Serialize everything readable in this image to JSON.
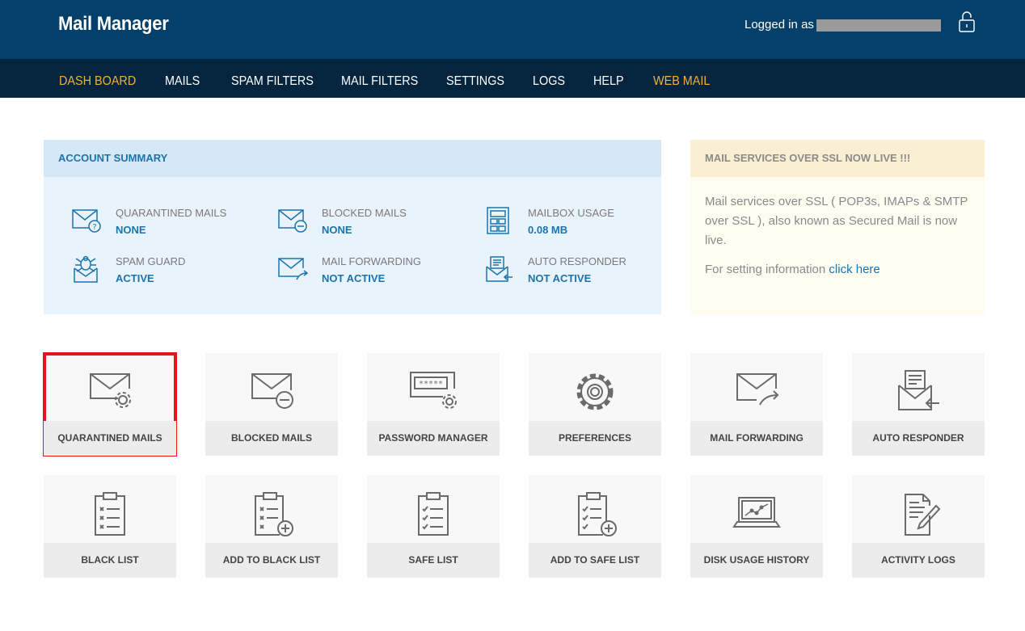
{
  "header": {
    "title": "Mail Manager",
    "login_label": "Logged in as",
    "lock_icon": "lock-icon"
  },
  "nav": [
    {
      "label": "DASH BOARD",
      "accent": true
    },
    {
      "label": "MAILS",
      "accent": false
    },
    {
      "label": "SPAM FILTERS",
      "accent": false
    },
    {
      "label": "MAIL FILTERS",
      "accent": false
    },
    {
      "label": "SETTINGS",
      "accent": false
    },
    {
      "label": "LOGS",
      "accent": false
    },
    {
      "label": "HELP",
      "accent": false
    },
    {
      "label": "WEB MAIL",
      "accent": true
    }
  ],
  "summary": {
    "title": "ACCOUNT SUMMARY",
    "items": [
      {
        "label": "QUARANTINED MAILS",
        "value": "NONE",
        "icon": "mail-question-icon"
      },
      {
        "label": "BLOCKED MAILS",
        "value": "NONE",
        "icon": "mail-blocked-icon"
      },
      {
        "label": "MAILBOX USAGE",
        "value": "0.08 MB",
        "icon": "storage-icon"
      },
      {
        "label": "SPAM GUARD",
        "value": "ACTIVE",
        "icon": "spam-guard-icon"
      },
      {
        "label": "MAIL FORWARDING",
        "value": "NOT ACTIVE",
        "icon": "mail-forward-icon"
      },
      {
        "label": "AUTO RESPONDER",
        "value": "NOT ACTIVE",
        "icon": "auto-responder-icon"
      }
    ]
  },
  "notice": {
    "title": "MAIL SERVICES OVER SSL NOW LIVE !!!",
    "body": "Mail services over SSL ( POP3s, IMAPs & SMTP over SSL ), also known as Secured Mail is now live.",
    "setting_prefix": "For setting information ",
    "link_text": "click here"
  },
  "tiles": [
    {
      "label": "QUARANTINED MAILS",
      "icon": "mail-gear-icon",
      "selected": true
    },
    {
      "label": "BLOCKED MAILS",
      "icon": "mail-blocked-icon"
    },
    {
      "label": "PASSWORD MANAGER",
      "icon": "password-gear-icon",
      "mask": "*****"
    },
    {
      "label": "PREFERENCES",
      "icon": "gear-icon"
    },
    {
      "label": "MAIL FORWARDING",
      "icon": "mail-forward-icon"
    },
    {
      "label": "AUTO RESPONDER",
      "icon": "auto-responder-icon"
    },
    {
      "label": "BLACK LIST",
      "icon": "clipboard-x-icon"
    },
    {
      "label": "ADD TO BLACK LIST",
      "icon": "clipboard-x-add-icon"
    },
    {
      "label": "SAFE LIST",
      "icon": "clipboard-check-icon"
    },
    {
      "label": "ADD TO SAFE LIST",
      "icon": "clipboard-check-add-icon"
    },
    {
      "label": "DISK USAGE HISTORY",
      "icon": "laptop-chart-icon"
    },
    {
      "label": "ACTIVITY LOGS",
      "icon": "document-pen-icon"
    }
  ],
  "colors": {
    "header_bg": "#04406a",
    "nav_bg": "#05253e",
    "accent": "#f0b13b",
    "link": "#1c74ad",
    "selection": "#e8121a"
  }
}
